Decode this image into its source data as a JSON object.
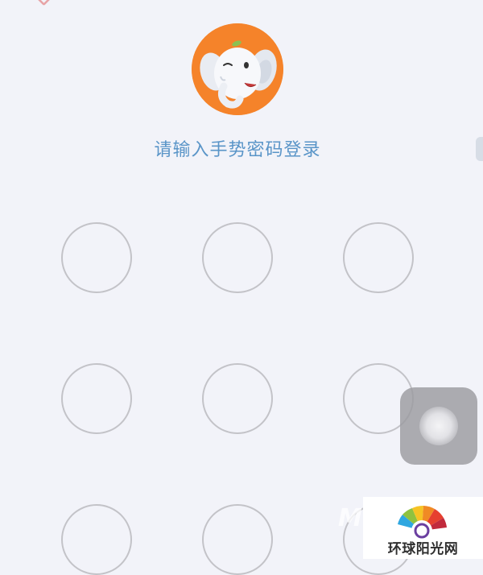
{
  "login": {
    "prompt": "请输入手势密码登录",
    "close_icon": "close-icon",
    "avatar_icon": "elephant-mascot-icon",
    "accent_color": "#f5832a",
    "prompt_color": "#5a95c8"
  },
  "gesture_pad": {
    "rows": 3,
    "columns": 3,
    "dot_color": "#c3c3c8"
  },
  "overlay": {
    "assistive_touch_icon": "assistive-touch-icon"
  },
  "watermark": {
    "site_name": "环球阳光网",
    "logo_icon": "rainbow-fan-logo",
    "stamp_text": "M"
  }
}
